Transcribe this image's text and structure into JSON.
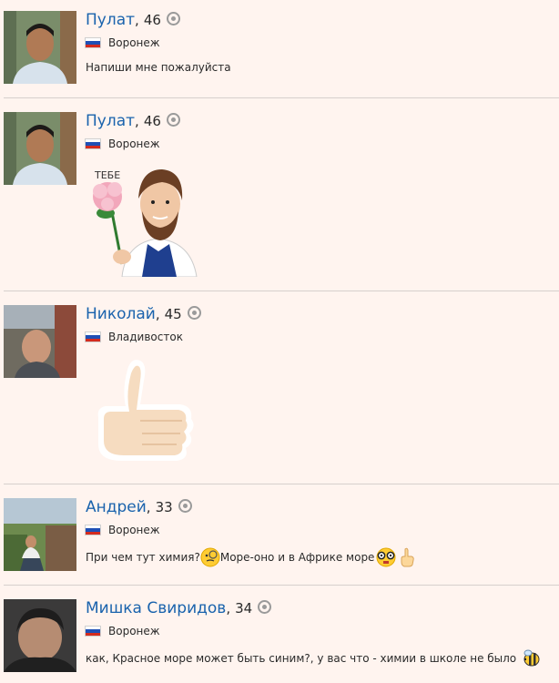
{
  "posts": [
    {
      "name": "Пулат",
      "age": "46",
      "city": "Воронеж",
      "message": "Напиши мне пожалуйста"
    },
    {
      "name": "Пулат",
      "age": "46",
      "city": "Воронеж",
      "sticker_caption": "ТЕБЕ"
    },
    {
      "name": "Николай",
      "age": "45",
      "city": "Владивосток"
    },
    {
      "name": "Андрей",
      "age": "33",
      "city": "Воронеж",
      "message_part1": "При чем тут химия?",
      "message_part2": " Море-оно и в Африке море"
    },
    {
      "name": "Мишка Свиридов",
      "age": "34",
      "city": "Воронеж",
      "message": "как, Красное море может быть синим?, у вас что - химии в школе не было"
    }
  ],
  "colors": {
    "background": "#fff4ef",
    "name_link": "#1a63ad",
    "divider": "#d6d0cd"
  }
}
